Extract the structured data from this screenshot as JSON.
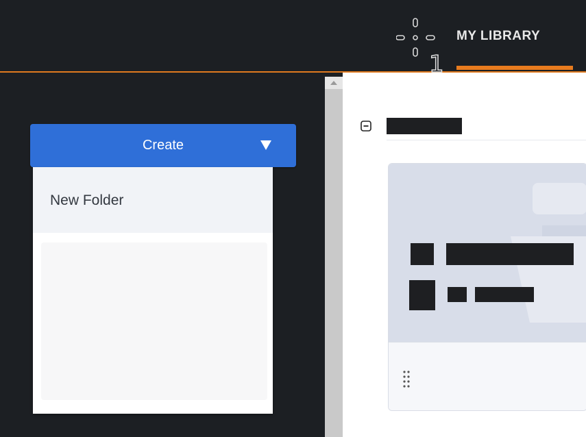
{
  "header": {
    "library_tab_label": "MY LIBRARY",
    "step_number": "1",
    "crosshair_icon": "crosshair-icon",
    "accent_color": "#e87b1e"
  },
  "create_menu": {
    "button_label": "Create",
    "caret_icon": "caret-down-icon",
    "items": [
      {
        "label": "New Folder"
      }
    ],
    "button_color": "#2f6fd8"
  },
  "content": {
    "collapse_icon": "collapse-minus-icon",
    "drag_handle_icon": "drag-handle-icon"
  }
}
